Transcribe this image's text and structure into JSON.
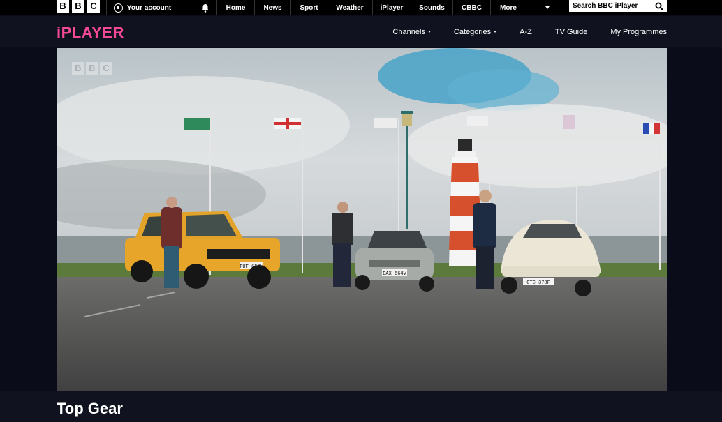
{
  "topbar": {
    "logo_letters": [
      "B",
      "B",
      "C"
    ],
    "account_label": "Your account",
    "nav": [
      {
        "label": "Home",
        "width": 54
      },
      {
        "label": "News",
        "width": 52
      },
      {
        "label": "Sport",
        "width": 52
      },
      {
        "label": "Weather",
        "width": 65
      },
      {
        "label": "iPlayer",
        "width": 55
      },
      {
        "label": "Sounds",
        "width": 60
      },
      {
        "label": "CBBC",
        "width": 54
      }
    ],
    "more_label": "More",
    "search_placeholder": "Search BBC iPlayer"
  },
  "iplayer": {
    "logo": "iPLAYER",
    "menu": {
      "channels": "Channels",
      "categories": "Categories",
      "az": "A-Z",
      "tv_guide": "TV Guide",
      "my_programmes": "My Programmes"
    }
  },
  "player": {
    "watermark_letters": [
      "B",
      "B",
      "C"
    ],
    "plates": {
      "yellow_car": "FUT 658V",
      "grey_car": "DAX 664V",
      "white_car": "GTC 378F"
    }
  },
  "programme": {
    "title": "Top Gear"
  },
  "colors": {
    "accent_pink": "#f54997",
    "bg_dark": "#0b0c1a",
    "header_bg": "#10121f"
  }
}
